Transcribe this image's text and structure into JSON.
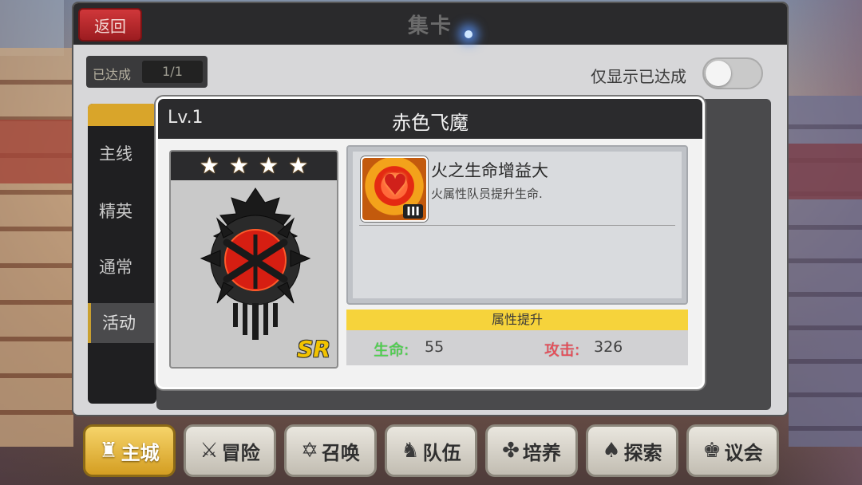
{
  "header": {
    "title": "集卡",
    "back_label": "返回"
  },
  "progress": {
    "label": "已达成",
    "count": "1/1"
  },
  "filter": {
    "label": "仅显示已达成",
    "enabled": false
  },
  "sidebar": {
    "items": [
      {
        "label": "主线",
        "active": false
      },
      {
        "label": "精英",
        "active": false
      },
      {
        "label": "通常",
        "active": false
      },
      {
        "label": "活动",
        "active": true
      }
    ]
  },
  "card_popup": {
    "level": "Lv.1",
    "name": "赤色飞魔",
    "stars": 4,
    "star_glyph": "★",
    "rarity": "SR",
    "skill": {
      "name": "火之生命增益大",
      "description": "火属性队员提升生命.",
      "rank": "III",
      "icon": "fire-heart-icon"
    },
    "attributes": {
      "header": "属性提升",
      "hp_label": "生命:",
      "hp_value": "55",
      "atk_label": "攻击:",
      "atk_value": "326"
    }
  },
  "bottom_nav": {
    "items": [
      {
        "label": "主城",
        "icon": "castle-icon",
        "glyph": "♜",
        "active": true
      },
      {
        "label": "冒险",
        "icon": "crossed-swords-icon",
        "glyph": "⚔",
        "active": false
      },
      {
        "label": "召唤",
        "icon": "summon-circle-icon",
        "glyph": "✡",
        "active": false
      },
      {
        "label": "队伍",
        "icon": "team-icon",
        "glyph": "♞",
        "active": false
      },
      {
        "label": "培养",
        "icon": "training-icon",
        "glyph": "✤",
        "active": false
      },
      {
        "label": "探索",
        "icon": "explore-icon",
        "glyph": "♠",
        "active": false
      },
      {
        "label": "议会",
        "icon": "council-icon",
        "glyph": "♚",
        "active": false
      }
    ]
  },
  "colors": {
    "accent_gold": "#f6d33b",
    "back_red": "#c22e31",
    "hp_green": "#4bd84b",
    "atk_red": "#f04a56"
  }
}
